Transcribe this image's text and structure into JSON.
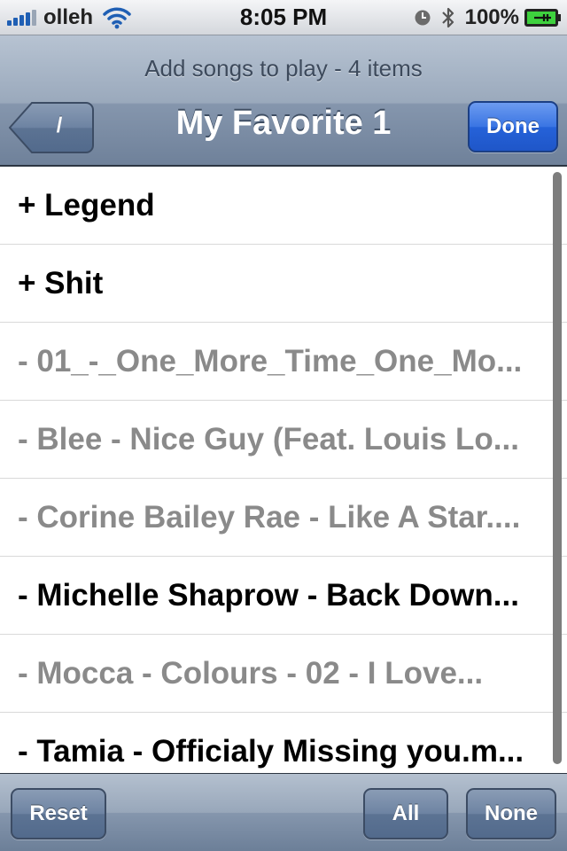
{
  "status_bar": {
    "carrier": "olleh",
    "time": "8:05 PM",
    "battery": "100%"
  },
  "navbar": {
    "prompt": "Add songs to play - 4 items",
    "title": "My Favorite 1",
    "back_label": "/",
    "done_label": "Done"
  },
  "items": [
    {
      "label": "+ Legend",
      "selected": true
    },
    {
      "label": "+ Shit",
      "selected": true
    },
    {
      "label": "- 01_-_One_More_Time_One_Mo...",
      "selected": false
    },
    {
      "label": "- Blee - Nice Guy (Feat. Louis Lo...",
      "selected": false
    },
    {
      "label": "- Corine Bailey Rae - Like A Star....",
      "selected": false
    },
    {
      "label": "- Michelle Shaprow - Back Down...",
      "selected": true
    },
    {
      "label": "- Mocca - Colours - 02 - I Love...",
      "selected": false
    },
    {
      "label": "- Tamia - Officialy Missing you.m...",
      "selected": true
    }
  ],
  "toolbar": {
    "reset_label": "Reset",
    "all_label": "All",
    "none_label": "None"
  },
  "colors": {
    "selected_text": "#000000",
    "unselected_text": "#8a8a8a",
    "done_button": "#2562d9",
    "navbar": "#8596ad"
  }
}
